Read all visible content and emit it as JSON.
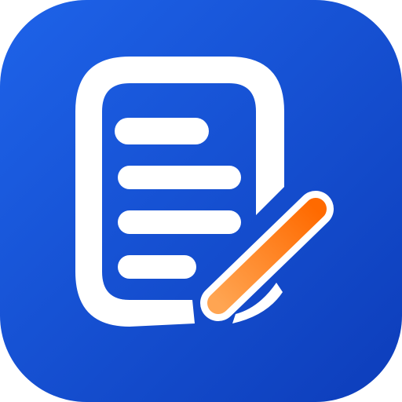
{
  "app_icon": {
    "icon_name": "document-edit-icon",
    "colors": {
      "background_top_left": "#1E63E9",
      "background_bottom_right": "#0D3DBA",
      "document": "#FFFFFF",
      "pencil_start": "#FFA552",
      "pencil_end": "#FF6A00"
    },
    "elements": {
      "document_lines": 4,
      "pencil": true
    }
  }
}
